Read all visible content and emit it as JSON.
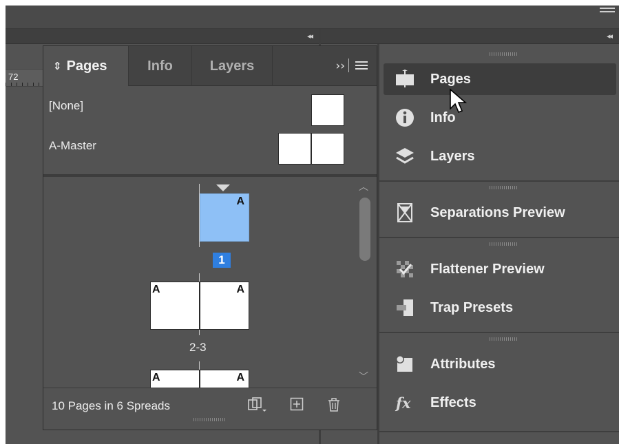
{
  "ruler": {
    "label": "72"
  },
  "pages_panel": {
    "tabs": [
      {
        "label": "Pages",
        "icon": "up-down-arrows-icon",
        "active": true
      },
      {
        "label": "Info",
        "active": false
      },
      {
        "label": "Layers",
        "active": false
      }
    ],
    "overflow_icon": "double-chevron-right-icon",
    "menu_icon": "panel-menu-icon",
    "masters": [
      {
        "label": "[None]"
      },
      {
        "label": "A-Master"
      }
    ],
    "pages": [
      {
        "label": "1",
        "selected": true,
        "master_letters": [
          "A"
        ]
      },
      {
        "label": "2-3",
        "selected": false,
        "master_letters": [
          "A",
          "A"
        ]
      },
      {
        "label": "",
        "selected": false,
        "master_letters": [
          "A",
          "A"
        ]
      }
    ],
    "footer": {
      "summary": "10 Pages in 6 Spreads",
      "icons": [
        "edit-page-size-icon",
        "new-page-icon",
        "delete-page-icon"
      ]
    }
  },
  "dock": {
    "items": [
      {
        "label": "Pages",
        "icon": "pages-icon",
        "active": true
      },
      {
        "label": "Info",
        "icon": "info-icon"
      },
      {
        "label": "Layers",
        "icon": "layers-icon"
      },
      {
        "label": "Separations Preview",
        "icon": "separations-preview-icon"
      },
      {
        "label": "Flattener Preview",
        "icon": "flattener-preview-icon"
      },
      {
        "label": "Trap Presets",
        "icon": "trap-presets-icon"
      },
      {
        "label": "Attributes",
        "icon": "attributes-icon"
      },
      {
        "label": "Effects",
        "icon": "effects-fx-icon"
      }
    ]
  },
  "colors": {
    "panel_bg": "#535353",
    "tabbar_bg": "#434343",
    "selected_page": "#8ec0f6",
    "selected_page_number": "#2f7fe0"
  }
}
